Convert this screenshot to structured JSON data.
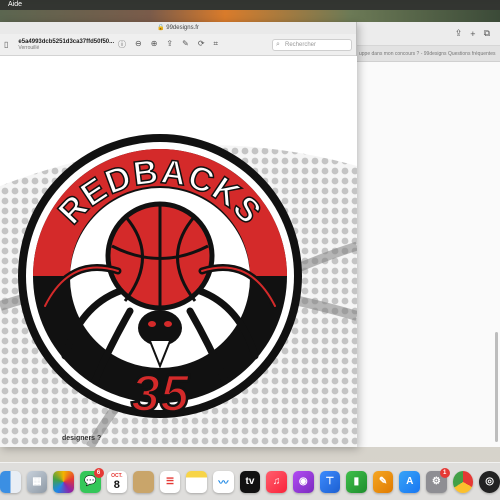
{
  "menubar": {
    "app_menu": "Aide"
  },
  "background_window": {
    "tab_text": "uppe dans mon concours ? - 99designs Questions fréquentes"
  },
  "preview_window": {
    "title": "99designs.fr",
    "document_name": "e5a4993dcb5251d3ca37ffd50f50...",
    "document_status": "Verrouillé",
    "search_placeholder": "Rechercher"
  },
  "logo": {
    "team_name": "REDBACKS",
    "number": "35",
    "colors": {
      "red": "#d42a2a",
      "black": "#111111",
      "white": "#ffffff"
    }
  },
  "footer_text": "designers ?",
  "dock": {
    "calendar_month": "OCT.",
    "calendar_day": "8",
    "messages_badge": "6",
    "bottom_badge": "1",
    "icons": [
      "finder-icon",
      "launchpad-icon",
      "photos-icon",
      "messages-icon",
      "calendar-icon",
      "finder-folder-icon",
      "reminders-icon",
      "notes-icon",
      "freeform-icon",
      "appletv-icon",
      "music-icon",
      "podcasts-icon",
      "keynote-icon",
      "numbers-icon",
      "pages-icon",
      "appstore-icon",
      "system-settings-icon",
      "chrome-icon",
      "obs-icon"
    ]
  }
}
